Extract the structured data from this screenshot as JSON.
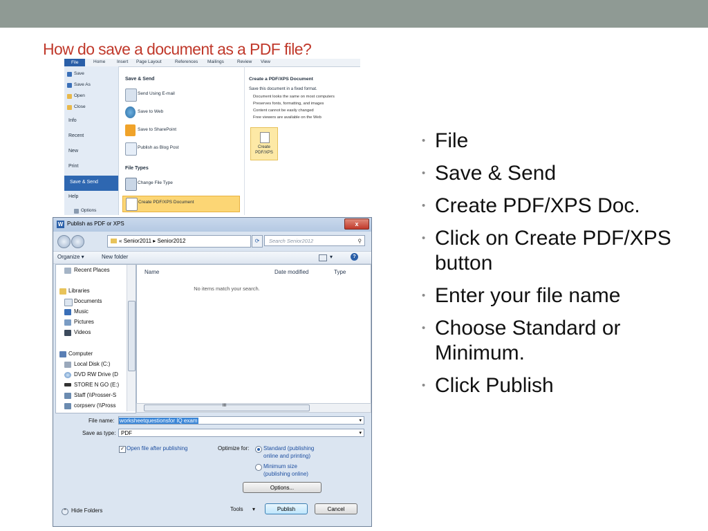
{
  "slide": {
    "title": "How do save a document as a PDF file?",
    "bullets": [
      "File",
      "Save & Send",
      "Create PDF/XPS Doc.",
      "Click on Create PDF/XPS button",
      "Enter your file name",
      "Choose Standard or Minimum.",
      "Click Publish"
    ]
  },
  "ribbon": {
    "tabs": [
      "File",
      "Home",
      "Insert",
      "Page Layout",
      "References",
      "Mailings",
      "Review",
      "View"
    ],
    "file_menu": [
      "Save",
      "Save As",
      "Open",
      "Close",
      "Info",
      "Recent",
      "New",
      "Print",
      "Save & Send",
      "Help",
      "Options"
    ],
    "save_send_heading": "Save & Send",
    "save_send_options": [
      "Send Using E-mail",
      "Save to Web",
      "Save to SharePoint",
      "Publish as Blog Post"
    ],
    "file_types_heading": "File Types",
    "file_types_options": [
      "Change File Type",
      "Create PDF/XPS Document"
    ],
    "pdf_panel": {
      "title": "Create a PDF/XPS Document",
      "desc": "Save this document in a fixed format.",
      "points": [
        "Document looks the same on most computers",
        "Preserves fonts, formatting, and images",
        "Content cannot be easily changed",
        "Free viewers are available on the Web"
      ],
      "button_line1": "Create",
      "button_line2": "PDF/XPS"
    }
  },
  "dialog": {
    "title": "Publish as PDF or XPS",
    "close_glyph": "x",
    "breadcrumb_prefix": "«",
    "breadcrumb": [
      "Senior2011",
      "Senior2012"
    ],
    "breadcrumb_sep": "▸",
    "search_placeholder": "Search Senior2012",
    "organize": "Organize ▾",
    "new_folder": "New folder",
    "view_glyph": "▾",
    "help_glyph": "?",
    "nav": {
      "recent_places": "Recent Places",
      "libraries": "Libraries",
      "documents": "Documents",
      "music": "Music",
      "pictures": "Pictures",
      "videos": "Videos",
      "computer": "Computer",
      "local_disk": "Local Disk (C:)",
      "dvd": "DVD RW Drive (D",
      "store": "STORE N GO (E:)",
      "staff": "Staff (\\\\Prosser-S",
      "corpserv": "corpserv (\\\\Pross"
    },
    "columns": {
      "name": "Name",
      "date": "Date modified",
      "type": "Type"
    },
    "empty_message": "No items match your search.",
    "file_name_label": "File name:",
    "file_name_value": "worksheetquestionsfor IQ exam",
    "save_type_label": "Save as type:",
    "save_type_value": "PDF",
    "open_after": "Open file after publishing",
    "optimize_label": "Optimize for:",
    "standard_line1": "Standard (publishing",
    "standard_line2": "online and printing)",
    "minimum_line1": "Minimum size",
    "minimum_line2": "(publishing online)",
    "options_button": "Options...",
    "hide_folders": "Hide Folders",
    "tools": "Tools",
    "publish_button": "Publish",
    "cancel_button": "Cancel",
    "hscroll_marker": "III"
  }
}
